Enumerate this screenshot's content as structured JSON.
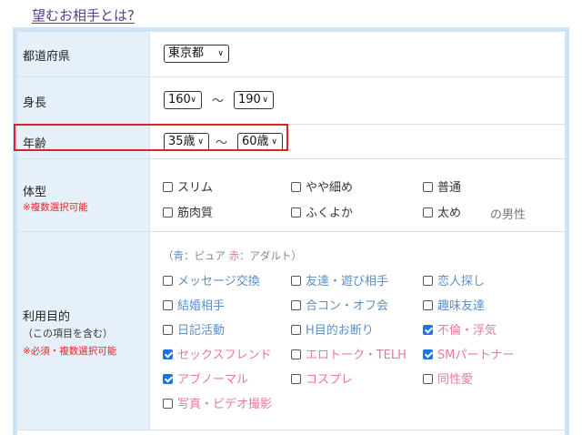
{
  "header": {
    "title_link": "望むお相手とは?"
  },
  "prefecture": {
    "label": "都道府県",
    "selected": "東京都"
  },
  "height": {
    "label": "身長",
    "from": "160",
    "separator": "～",
    "to": "190"
  },
  "age": {
    "label": "年齢",
    "from": "35歳",
    "separator": "～",
    "to": "60歳"
  },
  "body_type": {
    "label": "体型",
    "note": "※複数選択可能",
    "suffix": "の男性",
    "options": [
      {
        "label": "スリム",
        "checked": false
      },
      {
        "label": "やや細め",
        "checked": false
      },
      {
        "label": "普通",
        "checked": false
      },
      {
        "label": "筋肉質",
        "checked": false
      },
      {
        "label": "ふくよか",
        "checked": false
      },
      {
        "label": "太め",
        "checked": false
      }
    ]
  },
  "purpose": {
    "label": "利用目的",
    "sub_label": "（この項目を含む）",
    "note": "※必須・複数選択可能",
    "legend": {
      "open": "（",
      "blue_key": "青",
      "blue_desc": "：ピュア",
      "pink_key": "赤",
      "pink_desc": "：アダルト）"
    },
    "options": [
      {
        "label": "メッセージ交換",
        "checked": false,
        "category": "blue"
      },
      {
        "label": "友達・遊び相手",
        "checked": false,
        "category": "blue"
      },
      {
        "label": "恋人探し",
        "checked": false,
        "category": "blue"
      },
      {
        "label": "結婚相手",
        "checked": false,
        "category": "blue"
      },
      {
        "label": "合コン・オフ会",
        "checked": false,
        "category": "blue"
      },
      {
        "label": "趣味友達",
        "checked": false,
        "category": "blue"
      },
      {
        "label": "日記活動",
        "checked": false,
        "category": "blue"
      },
      {
        "label": "H目的お断り",
        "checked": false,
        "category": "blue"
      },
      {
        "label": "不倫・浮気",
        "checked": true,
        "category": "pink"
      },
      {
        "label": "セックスフレンド",
        "checked": true,
        "category": "pink"
      },
      {
        "label": "エロトーク・TELH",
        "checked": false,
        "category": "pink"
      },
      {
        "label": "SMパートナー",
        "checked": true,
        "category": "pink"
      },
      {
        "label": "アブノーマル",
        "checked": true,
        "category": "pink"
      },
      {
        "label": "コスプレ",
        "checked": false,
        "category": "pink"
      },
      {
        "label": "同性愛",
        "checked": false,
        "category": "pink"
      },
      {
        "label": "写真・ビデオ撮影",
        "checked": false,
        "category": "pink"
      }
    ]
  },
  "colors": {
    "label_bg": "#e6f0fa",
    "frame": "#cfe3f5",
    "highlight": "#e01f27",
    "pure_blue": "#5b8fc9",
    "adult_pink": "#e8789f",
    "note_red": "#e52421",
    "checkbox_checked": "#1a73e8"
  }
}
